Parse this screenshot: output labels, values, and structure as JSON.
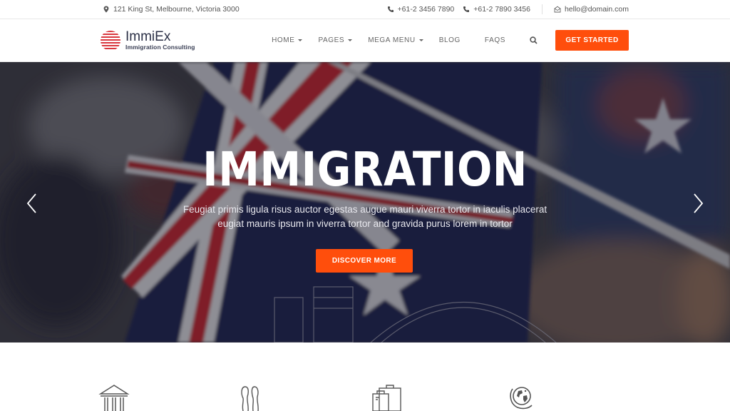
{
  "topbar": {
    "address": "121 King St, Melbourne, Victoria 3000",
    "phone1": "+61-2 3456 7890",
    "phone2": "+61-2 7890 3456",
    "email": "hello@domain.com"
  },
  "brand": {
    "name": "ImmiEx",
    "tagline": "Immigration Consulting",
    "accent": "#ff4e0c",
    "logo_color": "#d9363e"
  },
  "nav": {
    "items": [
      {
        "label": "HOME",
        "dropdown": true
      },
      {
        "label": "PAGES",
        "dropdown": true
      },
      {
        "label": "MEGA MENU",
        "dropdown": true
      },
      {
        "label": "BLOG",
        "dropdown": false
      },
      {
        "label": "FAQS",
        "dropdown": false
      }
    ],
    "cta": "GET STARTED"
  },
  "hero": {
    "title": "IMMIGRATION",
    "subtitle_line1": "Feugiat primis ligula risus auctor egestas augue mauri viverra tortor in iaculis placerat",
    "subtitle_line2": "eugiat mauris ipsum in viverra tortor and gravida purus lorem in tortor",
    "button": "DISCOVER MORE"
  },
  "features": {
    "icons": [
      "building-columns-icon",
      "footprints-icon",
      "luggage-icon",
      "globe-icon"
    ]
  }
}
